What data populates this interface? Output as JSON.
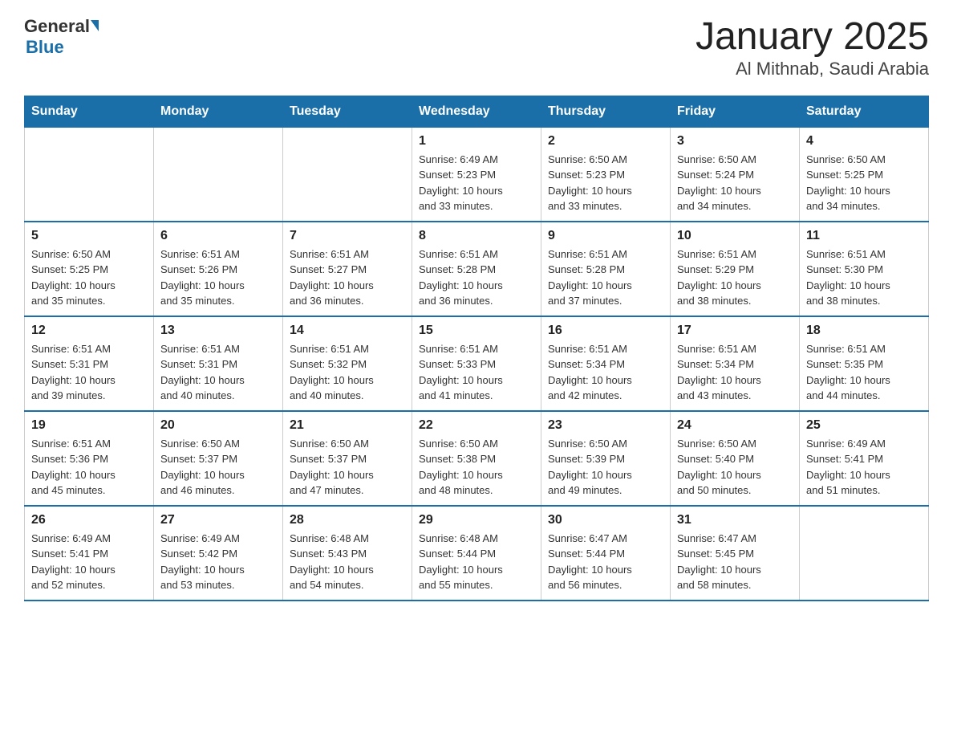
{
  "header": {
    "logo_general": "General",
    "logo_blue": "Blue",
    "title": "January 2025",
    "subtitle": "Al Mithnab, Saudi Arabia"
  },
  "days_of_week": [
    "Sunday",
    "Monday",
    "Tuesday",
    "Wednesday",
    "Thursday",
    "Friday",
    "Saturday"
  ],
  "weeks": [
    [
      {
        "day": "",
        "info": ""
      },
      {
        "day": "",
        "info": ""
      },
      {
        "day": "",
        "info": ""
      },
      {
        "day": "1",
        "info": "Sunrise: 6:49 AM\nSunset: 5:23 PM\nDaylight: 10 hours\nand 33 minutes."
      },
      {
        "day": "2",
        "info": "Sunrise: 6:50 AM\nSunset: 5:23 PM\nDaylight: 10 hours\nand 33 minutes."
      },
      {
        "day": "3",
        "info": "Sunrise: 6:50 AM\nSunset: 5:24 PM\nDaylight: 10 hours\nand 34 minutes."
      },
      {
        "day": "4",
        "info": "Sunrise: 6:50 AM\nSunset: 5:25 PM\nDaylight: 10 hours\nand 34 minutes."
      }
    ],
    [
      {
        "day": "5",
        "info": "Sunrise: 6:50 AM\nSunset: 5:25 PM\nDaylight: 10 hours\nand 35 minutes."
      },
      {
        "day": "6",
        "info": "Sunrise: 6:51 AM\nSunset: 5:26 PM\nDaylight: 10 hours\nand 35 minutes."
      },
      {
        "day": "7",
        "info": "Sunrise: 6:51 AM\nSunset: 5:27 PM\nDaylight: 10 hours\nand 36 minutes."
      },
      {
        "day": "8",
        "info": "Sunrise: 6:51 AM\nSunset: 5:28 PM\nDaylight: 10 hours\nand 36 minutes."
      },
      {
        "day": "9",
        "info": "Sunrise: 6:51 AM\nSunset: 5:28 PM\nDaylight: 10 hours\nand 37 minutes."
      },
      {
        "day": "10",
        "info": "Sunrise: 6:51 AM\nSunset: 5:29 PM\nDaylight: 10 hours\nand 38 minutes."
      },
      {
        "day": "11",
        "info": "Sunrise: 6:51 AM\nSunset: 5:30 PM\nDaylight: 10 hours\nand 38 minutes."
      }
    ],
    [
      {
        "day": "12",
        "info": "Sunrise: 6:51 AM\nSunset: 5:31 PM\nDaylight: 10 hours\nand 39 minutes."
      },
      {
        "day": "13",
        "info": "Sunrise: 6:51 AM\nSunset: 5:31 PM\nDaylight: 10 hours\nand 40 minutes."
      },
      {
        "day": "14",
        "info": "Sunrise: 6:51 AM\nSunset: 5:32 PM\nDaylight: 10 hours\nand 40 minutes."
      },
      {
        "day": "15",
        "info": "Sunrise: 6:51 AM\nSunset: 5:33 PM\nDaylight: 10 hours\nand 41 minutes."
      },
      {
        "day": "16",
        "info": "Sunrise: 6:51 AM\nSunset: 5:34 PM\nDaylight: 10 hours\nand 42 minutes."
      },
      {
        "day": "17",
        "info": "Sunrise: 6:51 AM\nSunset: 5:34 PM\nDaylight: 10 hours\nand 43 minutes."
      },
      {
        "day": "18",
        "info": "Sunrise: 6:51 AM\nSunset: 5:35 PM\nDaylight: 10 hours\nand 44 minutes."
      }
    ],
    [
      {
        "day": "19",
        "info": "Sunrise: 6:51 AM\nSunset: 5:36 PM\nDaylight: 10 hours\nand 45 minutes."
      },
      {
        "day": "20",
        "info": "Sunrise: 6:50 AM\nSunset: 5:37 PM\nDaylight: 10 hours\nand 46 minutes."
      },
      {
        "day": "21",
        "info": "Sunrise: 6:50 AM\nSunset: 5:37 PM\nDaylight: 10 hours\nand 47 minutes."
      },
      {
        "day": "22",
        "info": "Sunrise: 6:50 AM\nSunset: 5:38 PM\nDaylight: 10 hours\nand 48 minutes."
      },
      {
        "day": "23",
        "info": "Sunrise: 6:50 AM\nSunset: 5:39 PM\nDaylight: 10 hours\nand 49 minutes."
      },
      {
        "day": "24",
        "info": "Sunrise: 6:50 AM\nSunset: 5:40 PM\nDaylight: 10 hours\nand 50 minutes."
      },
      {
        "day": "25",
        "info": "Sunrise: 6:49 AM\nSunset: 5:41 PM\nDaylight: 10 hours\nand 51 minutes."
      }
    ],
    [
      {
        "day": "26",
        "info": "Sunrise: 6:49 AM\nSunset: 5:41 PM\nDaylight: 10 hours\nand 52 minutes."
      },
      {
        "day": "27",
        "info": "Sunrise: 6:49 AM\nSunset: 5:42 PM\nDaylight: 10 hours\nand 53 minutes."
      },
      {
        "day": "28",
        "info": "Sunrise: 6:48 AM\nSunset: 5:43 PM\nDaylight: 10 hours\nand 54 minutes."
      },
      {
        "day": "29",
        "info": "Sunrise: 6:48 AM\nSunset: 5:44 PM\nDaylight: 10 hours\nand 55 minutes."
      },
      {
        "day": "30",
        "info": "Sunrise: 6:47 AM\nSunset: 5:44 PM\nDaylight: 10 hours\nand 56 minutes."
      },
      {
        "day": "31",
        "info": "Sunrise: 6:47 AM\nSunset: 5:45 PM\nDaylight: 10 hours\nand 58 minutes."
      },
      {
        "day": "",
        "info": ""
      }
    ]
  ]
}
